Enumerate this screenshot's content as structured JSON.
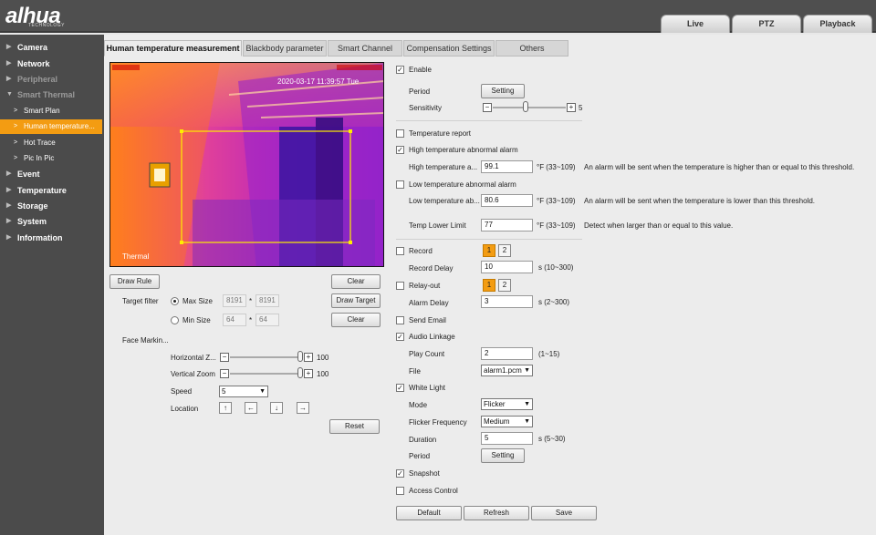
{
  "brand": {
    "logo": "alhua",
    "sub": "TECHNOLOGY"
  },
  "top_tabs": [
    "Live",
    "PTZ",
    "Playback"
  ],
  "sidebar": [
    {
      "label": "Camera"
    },
    {
      "label": "Network"
    },
    {
      "label": "Peripheral"
    },
    {
      "label": "Smart Thermal"
    },
    {
      "label": "Smart Plan"
    },
    {
      "label": "Human temperature..."
    },
    {
      "label": "Hot Trace"
    },
    {
      "label": "Pic In Pic"
    },
    {
      "label": "Event"
    },
    {
      "label": "Temperature"
    },
    {
      "label": "Storage"
    },
    {
      "label": "System"
    },
    {
      "label": "Information"
    }
  ],
  "tabs": [
    "Human temperature measurement",
    "Blackbody parameter",
    "Smart Channel",
    "Compensation Settings",
    "Others"
  ],
  "video": {
    "timestamp": "2020-03-17 11:39:57 Tue",
    "channel_label": "Thermal"
  },
  "left": {
    "draw_rule": "Draw Rule",
    "clear1": "Clear",
    "target_filter": "Target filter",
    "max_size": "Max Size",
    "max_w": "8191",
    "max_h": "8191",
    "star": "*",
    "draw_target": "Draw Target",
    "min_size": "Min Size",
    "min_w": "64",
    "min_h": "64",
    "clear2": "Clear",
    "face_marking": "Face Markin...",
    "hzoom_label": "Horizontal Z...",
    "hzoom_value": "100",
    "hzoom_level": 1.0,
    "vzoom_label": "Vertical Zoom",
    "vzoom_value": "100",
    "vzoom_level": 1.0,
    "speed_label": "Speed",
    "speed_value": "5",
    "location_label": "Location",
    "reset": "Reset",
    "minus": "−",
    "plus": "+"
  },
  "right": {
    "enable": "Enable",
    "period": "Period",
    "setting": "Setting",
    "sensitivity": "Sensitivity",
    "sensitivity_value": "5",
    "sensitivity_level": 0.44,
    "temp_report": "Temperature report",
    "high_alarm": "High temperature abnormal alarm",
    "high_label": "High temperature a...",
    "high_value": "99.1",
    "high_range": "°F (33~109)",
    "high_note": "An alarm will be sent when the temperature is higher than or equal to this threshold.",
    "low_alarm": "Low temperature abnormal alarm",
    "low_label": "Low temperature ab...",
    "low_value": "80.6",
    "low_range": "°F (33~109)",
    "low_note": "An alarm will be sent when the temperature is lower than this threshold.",
    "tll_label": "Temp Lower Limit",
    "tll_value": "77",
    "tll_range": "°F (33~109)",
    "tll_note": "Detect when larger than or equal to this value.",
    "record": "Record",
    "rec_btn1": "1",
    "rec_btn2": "2",
    "record_delay": "Record Delay",
    "record_delay_value": "10",
    "record_delay_range": "s (10~300)",
    "relay": "Relay-out",
    "relay_btn1": "1",
    "relay_btn2": "2",
    "alarm_delay": "Alarm Delay",
    "alarm_delay_value": "3",
    "alarm_delay_range": "s (2~300)",
    "send_email": "Send Email",
    "audio": "Audio Linkage",
    "play_count": "Play Count",
    "play_count_value": "2",
    "play_count_range": "(1~15)",
    "file": "File",
    "file_value": "alarm1.pcm",
    "white_light": "White Light",
    "mode": "Mode",
    "mode_value": "Flicker",
    "flicker_freq": "Flicker Frequency",
    "flicker_value": "Medium",
    "duration": "Duration",
    "duration_value": "5",
    "duration_range": "s (5~30)",
    "period2": "Period",
    "setting2": "Setting",
    "snapshot": "Snapshot",
    "access": "Access Control",
    "default": "Default",
    "refresh": "Refresh",
    "save": "Save",
    "check": "✓"
  }
}
